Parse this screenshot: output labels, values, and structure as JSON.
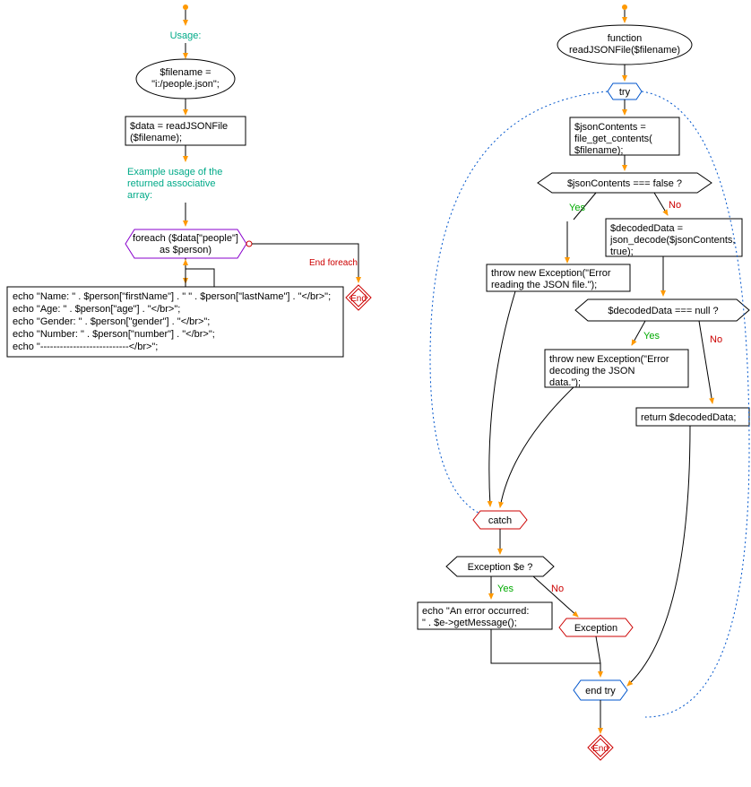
{
  "left": {
    "usage_label": "Usage:",
    "filename_box": "$filename = \"i:/people.json\";",
    "data_box": "$data = readJSONFile($filename);",
    "example_label": "Example usage of the returned associative array:",
    "foreach_box": "foreach ($data[\"people\"] as $person)",
    "end_foreach": "End foreach",
    "echo_block": "echo \"Name: \" . $person[\"firstName\"] . \" \" . $person[\"lastName\"] . \"</br>\";\necho \"Age: \" . $person[\"age\"] . \"</br>\";\necho \"Gender: \" . $person[\"gender\"] . \"</br>\";\necho \"Number: \" . $person[\"number\"] . \"</br>\";\necho \"---------------------------</br>\";",
    "end": "End"
  },
  "right": {
    "func_box": "function readJSONFile($filename)",
    "try": "try",
    "json_contents": "$jsonContents = file_get_contents($filename);",
    "cond1": "$jsonContents === false ?",
    "yes": "Yes",
    "no": "No",
    "decoded_box": "$decodedData = json_decode($jsonContents, true);",
    "throw1": "throw new Exception(\"Error reading the JSON file.\");",
    "cond2": "$decodedData === null ?",
    "throw2": "throw new Exception(\"Error decoding the JSON data.\");",
    "return_box": "return $decodedData;",
    "catch": "catch",
    "cond3": "Exception $e ?",
    "echo_err": "echo \"An error occurred: \" . $e->getMessage();",
    "exception_box": "Exception",
    "end_try": "end try",
    "end": "End"
  }
}
